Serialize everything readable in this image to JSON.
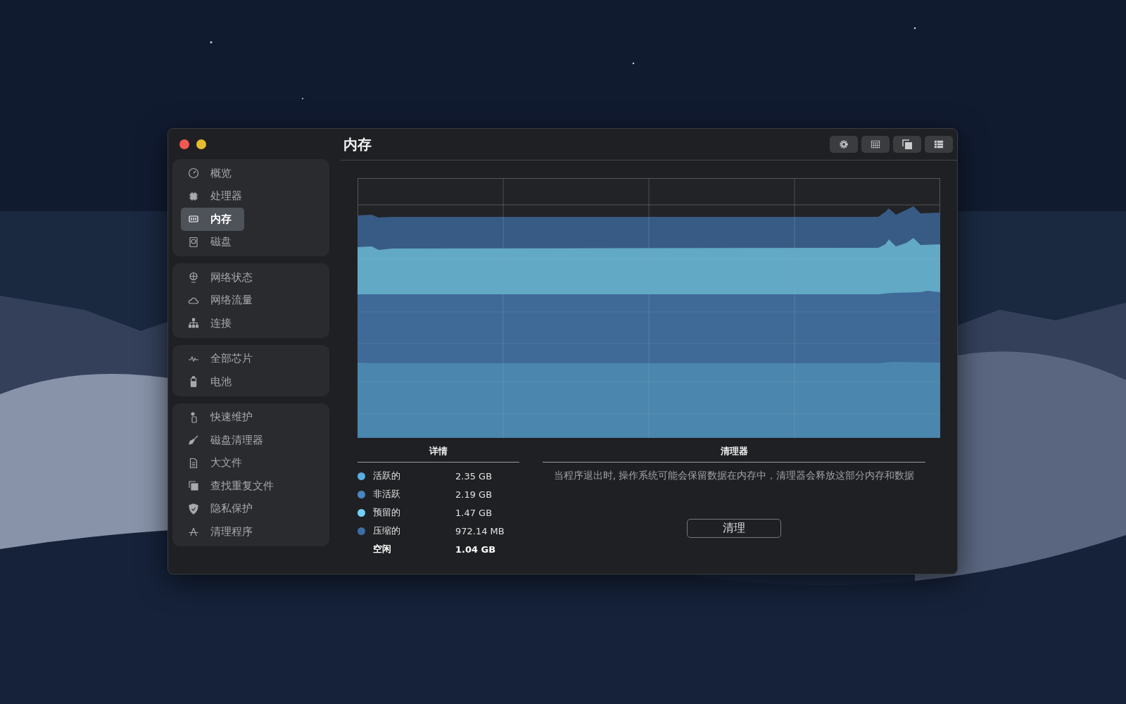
{
  "window": {
    "title": "内存"
  },
  "sidebar": {
    "groups": [
      {
        "items": [
          {
            "label": "概览",
            "selected": false
          },
          {
            "label": "处理器",
            "selected": false
          },
          {
            "label": "内存",
            "selected": true
          },
          {
            "label": "磁盘",
            "selected": false
          }
        ]
      },
      {
        "items": [
          {
            "label": "网络状态",
            "selected": false
          },
          {
            "label": "网络流量",
            "selected": false
          },
          {
            "label": "连接",
            "selected": false
          }
        ]
      },
      {
        "items": [
          {
            "label": "全部芯片",
            "selected": false
          },
          {
            "label": "电池",
            "selected": false
          }
        ]
      },
      {
        "items": [
          {
            "label": "快速维护",
            "selected": false
          },
          {
            "label": "磁盘清理器",
            "selected": false
          },
          {
            "label": "大文件",
            "selected": false
          },
          {
            "label": "查找重复文件",
            "selected": false
          },
          {
            "label": "隐私保护",
            "selected": false
          },
          {
            "label": "清理程序",
            "selected": false
          }
        ]
      }
    ]
  },
  "details": {
    "title": "详情",
    "rows": [
      {
        "label": "活跃的",
        "value": "2.35 GB",
        "color": "#5aaee0",
        "bold": false
      },
      {
        "label": "非活跃",
        "value": "2.19 GB",
        "color": "#4a86c0",
        "bold": false
      },
      {
        "label": "预留的",
        "value": "1.47 GB",
        "color": "#72d0f5",
        "bold": false
      },
      {
        "label": "压缩的",
        "value": "972.14 MB",
        "color": "#3c6ea6",
        "bold": false
      },
      {
        "label": "空闲",
        "value": "1.04 GB",
        "bold": true
      }
    ]
  },
  "cleaner": {
    "title": "清理器",
    "description": "当程序退出时, 操作系统可能会保留数据在内存中，清理器会释放这部分内存和数据",
    "button": "清理"
  }
}
